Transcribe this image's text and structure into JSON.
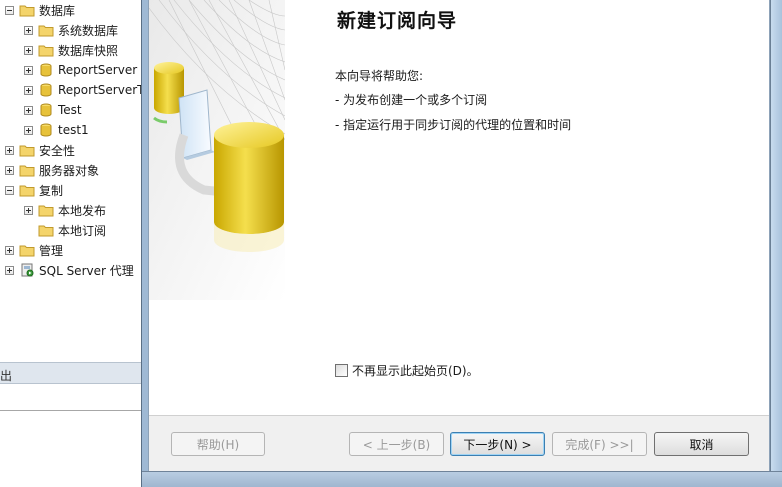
{
  "explorer": {
    "items": [
      {
        "label": "数据库",
        "icon": "folder-icon",
        "expander": "minus",
        "level": 0
      },
      {
        "label": "系统数据库",
        "icon": "folder-icon",
        "expander": "plus",
        "level": 1
      },
      {
        "label": "数据库快照",
        "icon": "folder-icon",
        "expander": "plus",
        "level": 1
      },
      {
        "label": "ReportServer",
        "icon": "database-icon",
        "expander": "plus",
        "level": 1
      },
      {
        "label": "ReportServerTempDB",
        "icon": "database-icon",
        "expander": "plus",
        "level": 1
      },
      {
        "label": "Test",
        "icon": "database-icon",
        "expander": "plus",
        "level": 1
      },
      {
        "label": "test1",
        "icon": "database-icon",
        "expander": "plus",
        "level": 1
      },
      {
        "label": "安全性",
        "icon": "folder-icon",
        "expander": "plus",
        "level": 0
      },
      {
        "label": "服务器对象",
        "icon": "folder-icon",
        "expander": "plus",
        "level": 0
      },
      {
        "label": "复制",
        "icon": "folder-icon",
        "expander": "minus",
        "level": 0
      },
      {
        "label": "本地发布",
        "icon": "folder-icon",
        "expander": "plus",
        "level": 1
      },
      {
        "label": "本地订阅",
        "icon": "folder-icon",
        "expander": "none",
        "level": 1
      },
      {
        "label": "管理",
        "icon": "folder-icon",
        "expander": "plus",
        "level": 0
      },
      {
        "label": "SQL Server 代理",
        "icon": "sql-agent-icon",
        "expander": "plus",
        "level": 0
      }
    ],
    "output_label": "出"
  },
  "wizard": {
    "title": "新建订阅向导",
    "intro": "本向导将帮助您:",
    "bullets": [
      "- 为发布创建一个或多个订阅",
      "- 指定运行用于同步订阅的代理的位置和时间"
    ],
    "skip_label": "不再显示此起始页(D)。",
    "skip_checked": false,
    "buttons": {
      "help": "帮助(H)",
      "back": "< 上一步(B)",
      "next": "下一步(N) >",
      "finish": "完成(F) >>|",
      "cancel": "取消"
    }
  },
  "colors": {
    "folder": "#f4d46b",
    "database": "#e7c23a",
    "button_focus": "#3c7fb1",
    "frame": "#9fb9d4"
  }
}
